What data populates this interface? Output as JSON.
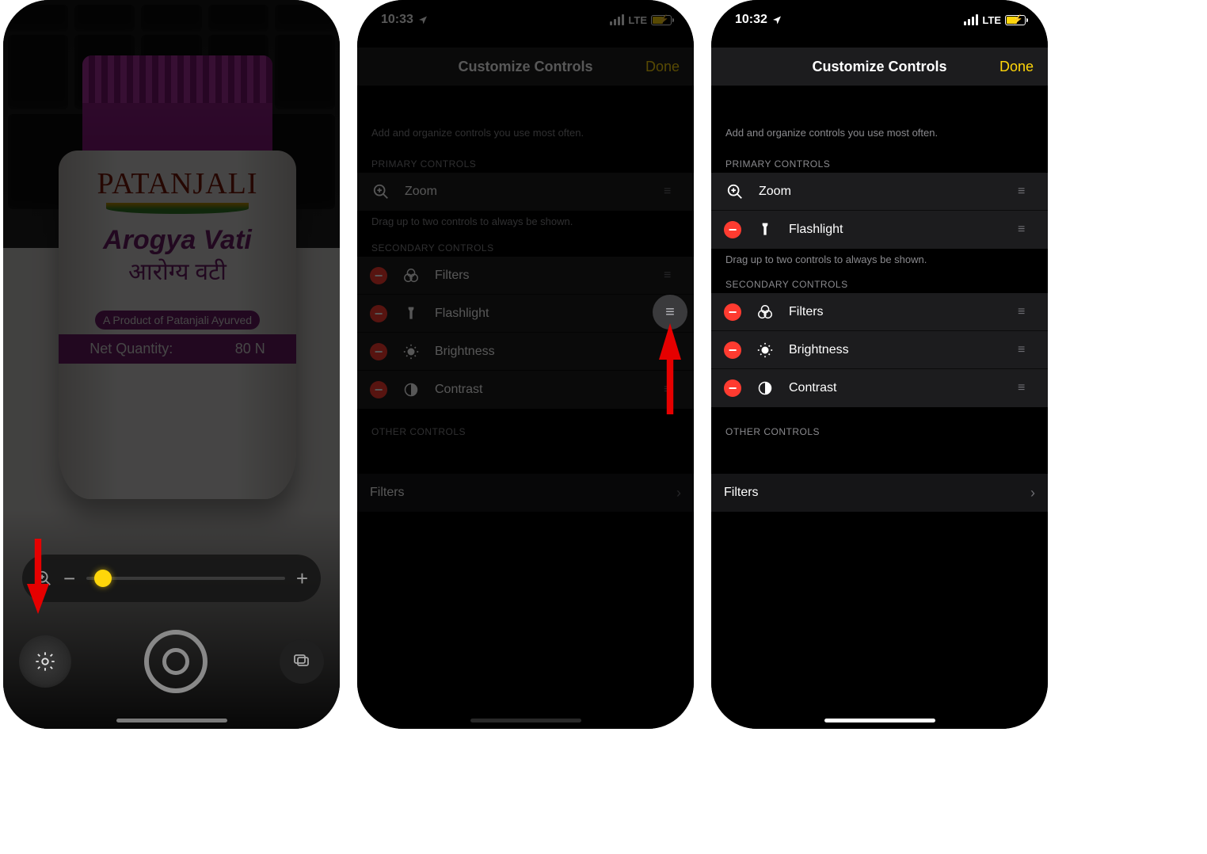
{
  "screen1": {
    "brand": "PATANJALI",
    "product_en": "Arogya Vati",
    "product_hi": "आरोग्य वटी",
    "subline": "A Product of Patanjali Ayurved",
    "qty_label": "Net Quantity:",
    "qty_value": "80 N"
  },
  "screen2": {
    "time": "10:33",
    "network": "LTE",
    "title": "Customize Controls",
    "done": "Done",
    "hint": "Add and organize controls you use most often.",
    "primary_header": "PRIMARY CONTROLS",
    "primary": [
      {
        "label": "Zoom"
      }
    ],
    "primary_hint": "Drag up to two controls to always be shown.",
    "secondary_header": "SECONDARY CONTROLS",
    "secondary": [
      {
        "label": "Filters"
      },
      {
        "label": "Flashlight"
      },
      {
        "label": "Brightness"
      },
      {
        "label": "Contrast"
      }
    ],
    "other_header": "OTHER CONTROLS",
    "other": [
      {
        "label": "Filters"
      }
    ]
  },
  "screen3": {
    "time": "10:32",
    "network": "LTE",
    "title": "Customize Controls",
    "done": "Done",
    "hint": "Add and organize controls you use most often.",
    "primary_header": "PRIMARY CONTROLS",
    "primary": [
      {
        "label": "Zoom"
      },
      {
        "label": "Flashlight"
      }
    ],
    "primary_hint": "Drag up to two controls to always be shown.",
    "secondary_header": "SECONDARY CONTROLS",
    "secondary": [
      {
        "label": "Filters"
      },
      {
        "label": "Brightness"
      },
      {
        "label": "Contrast"
      }
    ],
    "other_header": "OTHER CONTROLS",
    "other": [
      {
        "label": "Filters"
      }
    ]
  },
  "colors": {
    "accent": "#ffd60a",
    "remove": "#ff3b30",
    "arrow": "#e60000"
  }
}
